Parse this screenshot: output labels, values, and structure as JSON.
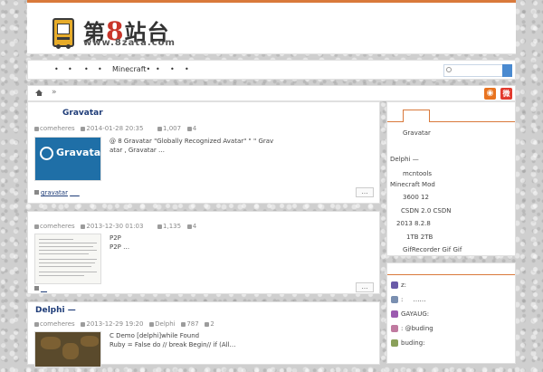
{
  "logo": {
    "title_a": "第",
    "title_eight": "8",
    "title_b": "站台",
    "url": "www.8zata.com"
  },
  "nav": {
    "items": [
      "•",
      "•",
      "•",
      "•",
      "Minecraft•",
      "•",
      "•",
      "•"
    ]
  },
  "breadcrumb": {
    "sep": "»"
  },
  "posts": [
    {
      "title": "Gravatar",
      "author": "comeheres",
      "date": "2014-01-28 20:35",
      "views": "1,007",
      "comments": "4",
      "thumb_text": "Gravatar",
      "excerpt_1": "@               8        Gravatar       \"Globally Recognized Avatar\"   \"   \"        Grav",
      "excerpt_2": "atar              ,                   Gravatar                     …",
      "tag": "gravatar",
      "tag_extra": "___",
      "more": "…"
    },
    {
      "title": "",
      "author": "comeheres",
      "date": "2013-12-30 01:03",
      "views": "1,135",
      "comments": "4",
      "excerpt_1": "                                                                               P2P",
      "excerpt_2": "                         P2P                         …",
      "tag": "__",
      "more": "…"
    },
    {
      "title": "Delphi            —",
      "author": "comeheres",
      "date": "2013-12-29 19:20",
      "category": "Delphi",
      "views": "787",
      "comments": "2",
      "excerpt_1": "C                           Demo                                                                    [delphi]while Found",
      "excerpt_2": "Ruby = False do //                      break    Begin//            if (All…"
    }
  ],
  "sidebar": {
    "recent_items": [
      "Gravatar",
      "Delphi      —",
      "mcntools",
      "Minecraft Mod",
      "3600     12",
      "CSDN        2.0          CSDN",
      "2013 8.2.8",
      "1TB                   2TB",
      "GifRecorder   Gif       Gif"
    ],
    "comments": [
      {
        "name": "z:",
        "text": "",
        "color": "#6a5aa8"
      },
      {
        "name": ":",
        "text": "……",
        "color": "#7a8fb0"
      },
      {
        "name": "GAYAUG:",
        "text": "",
        "color": "#9c5ab0"
      },
      {
        "name": ": @buding",
        "text": "",
        "color": "#c07aa0"
      },
      {
        "name": "buding:",
        "text": "",
        "color": "#8aa05a"
      }
    ]
  }
}
